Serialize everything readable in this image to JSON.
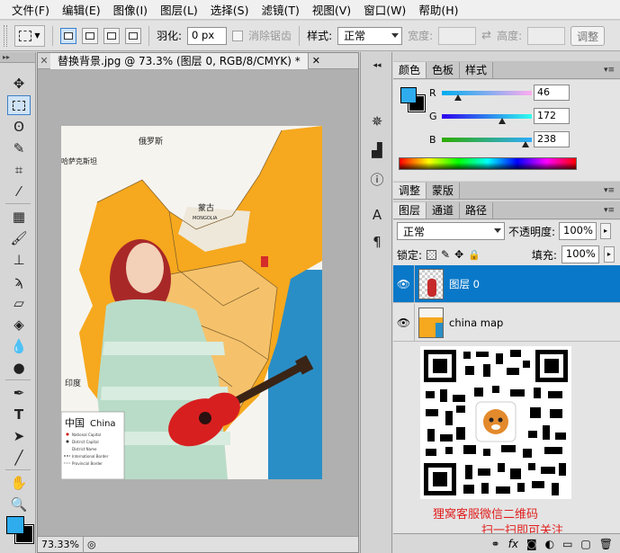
{
  "menu": [
    "文件(F)",
    "编辑(E)",
    "图像(I)",
    "图层(L)",
    "选择(S)",
    "滤镜(T)",
    "视图(V)",
    "窗口(W)",
    "帮助(H)"
  ],
  "options": {
    "feather_label": "羽化:",
    "feather_value": "0 px",
    "antialias_label": "消除锯齿",
    "style_label": "样式:",
    "style_value": "正常",
    "width_label": "宽度:",
    "height_label": "高度:",
    "refine_label": "调整"
  },
  "document": {
    "tab_title": "替换背景.jpg @ 73.3% (图层 0, RGB/8/CMYK) *",
    "zoom": "73.33%",
    "map_labels": {
      "russia": "俄罗斯",
      "kazakhstan": "哈萨克斯坦",
      "mongolia": "蒙古",
      "mongolia_en": "MONGOLIA",
      "india": "印度",
      "legend_title_cn": "中国",
      "legend_title_en": "China",
      "legend_1": "National Capital",
      "legend_2": "District Capital",
      "legend_3": "District Name",
      "legend_4": "International Border",
      "legend_5": "Provincial Border"
    }
  },
  "color_panel": {
    "tabs": [
      "颜色",
      "色板",
      "样式"
    ],
    "r_label": "R",
    "g_label": "G",
    "b_label": "B",
    "r": "46",
    "g": "172",
    "b": "238",
    "foreground": "#2eacee",
    "background": "#000000"
  },
  "adjust_panel": {
    "tabs": [
      "调整",
      "蒙版"
    ]
  },
  "layers_panel": {
    "tabs": [
      "图层",
      "通道",
      "路径"
    ],
    "blend_mode": "正常",
    "opacity_label": "不透明度:",
    "opacity": "100%",
    "lock_label": "锁定:",
    "fill_label": "填充:",
    "fill": "100%",
    "layers": [
      {
        "name": "图层 0",
        "selected": true
      },
      {
        "name": "china map",
        "selected": false
      }
    ],
    "qr_caption_1": "狸窝客服微信二维码",
    "qr_caption_2": "扫一扫即可关注"
  }
}
